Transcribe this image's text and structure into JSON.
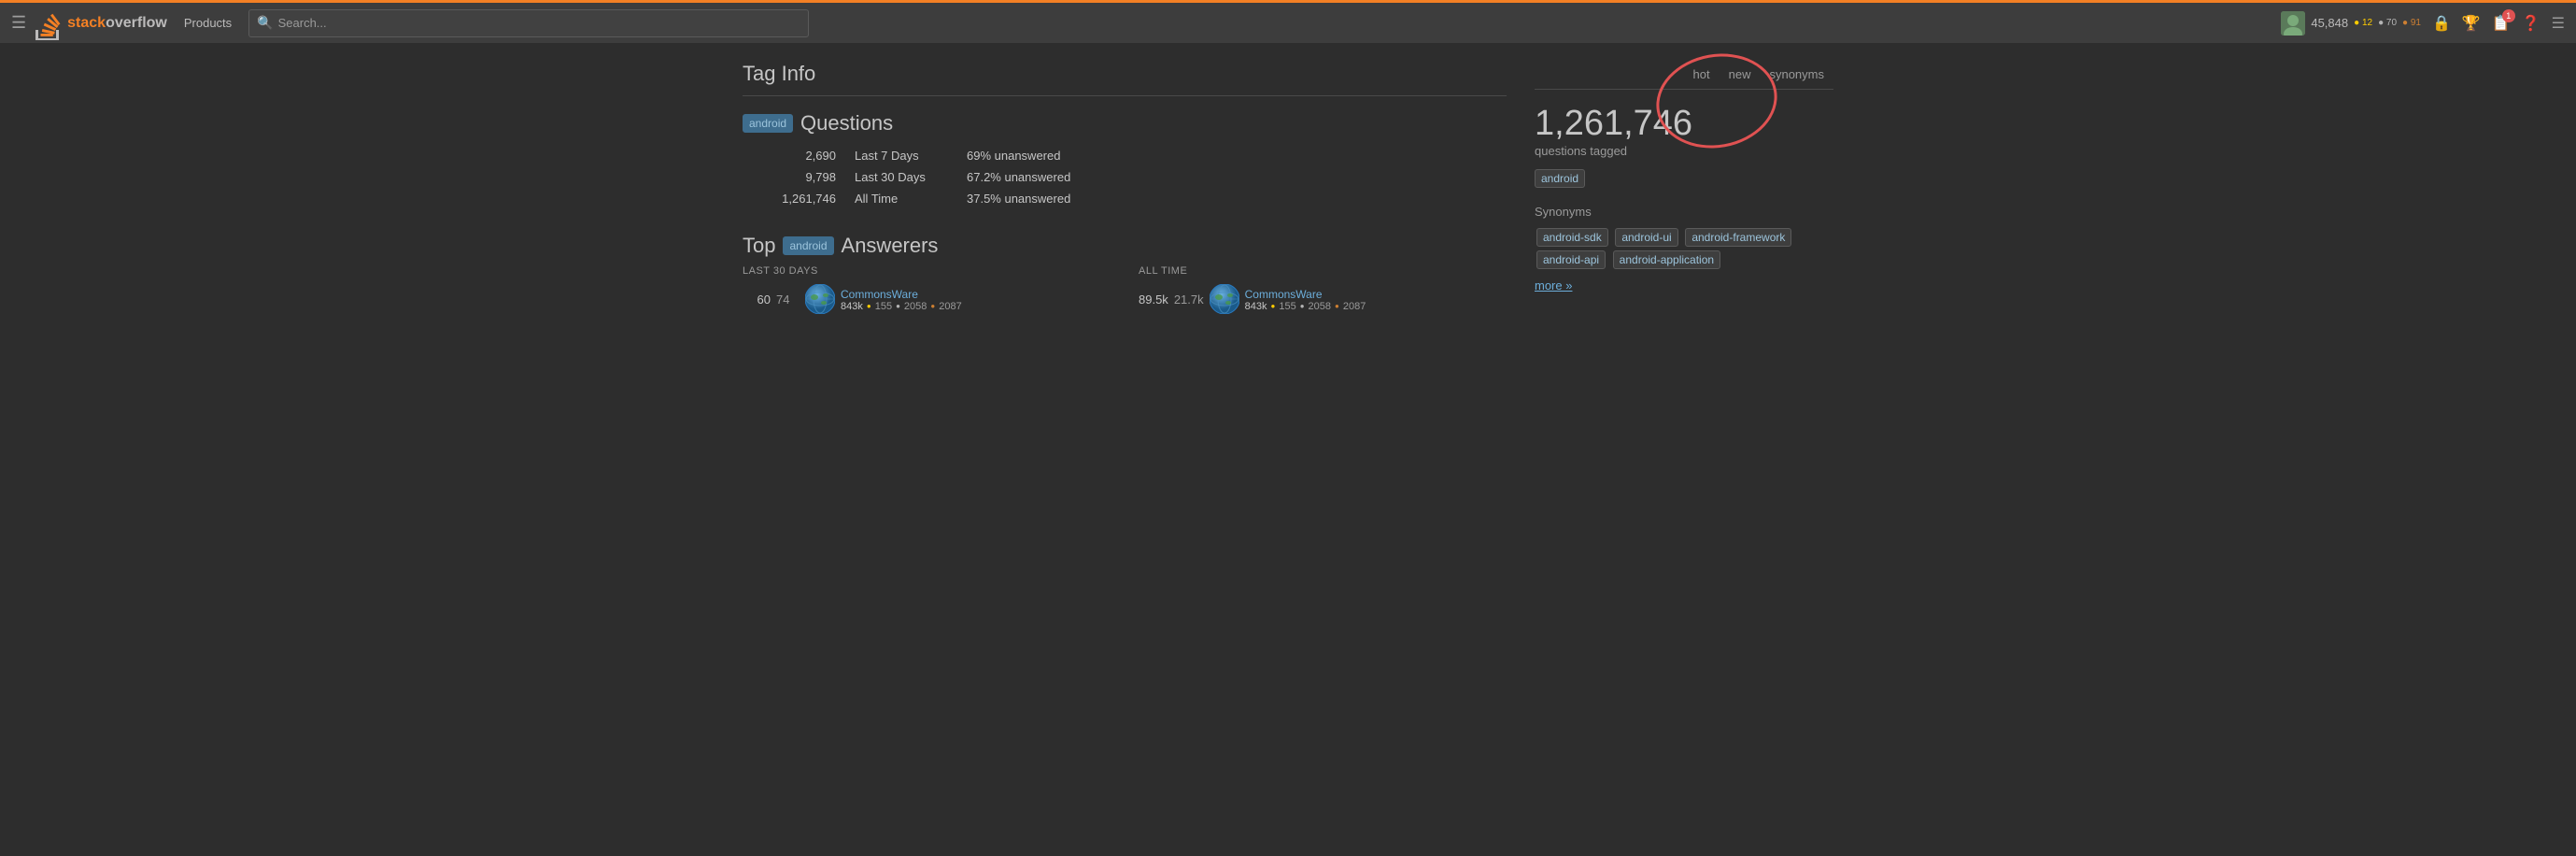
{
  "header": {
    "logo_text_part1": "stack",
    "logo_text_part2": "overflow",
    "products_label": "Products",
    "search_placeholder": "Search...",
    "user_rep": "45,848",
    "user_gold": "12",
    "user_silver": "70",
    "user_bronze": "91",
    "inbox_badge": "1"
  },
  "page": {
    "tag_info_title": "Tag Info",
    "sidebar_tabs": [
      {
        "label": "hot",
        "active": false
      },
      {
        "label": "new",
        "active": false
      },
      {
        "label": "synonyms",
        "active": false
      }
    ],
    "questions_count_big": "1,261,746",
    "questions_count_label": "questions tagged",
    "main_tag": "android",
    "synonyms_title": "Synonyms",
    "synonym_chips": [
      "android-sdk",
      "android-ui",
      "android-framework",
      "android-api",
      "android-application"
    ],
    "more_link_text": "more »"
  },
  "questions": {
    "heading_tag": "android",
    "heading_text": "Questions",
    "stats": [
      {
        "number": "2,690",
        "period": "Last 7 Days",
        "unanswered": "69% unanswered"
      },
      {
        "number": "9,798",
        "period": "Last 30 Days",
        "unanswered": "67.2% unanswered"
      },
      {
        "number": "1,261,746",
        "period": "All Time",
        "unanswered": "37.5% unanswered"
      }
    ]
  },
  "top_answerers": {
    "heading_tag": "android",
    "heading_text": "Answerers",
    "last30_label": "Last 30 Days",
    "alltime_label": "All Time",
    "last30_entries": [
      {
        "score": "60",
        "answers": "74",
        "name": "CommonsWare",
        "rep": "843k",
        "gold": "155",
        "silver": "2058",
        "bronze": "2087"
      }
    ],
    "alltime_entries": [
      {
        "score": "89.5k",
        "answers": "21.7k",
        "name": "CommonsWare",
        "rep": "843k",
        "gold": "155",
        "silver": "2058",
        "bronze": "2087"
      }
    ]
  }
}
